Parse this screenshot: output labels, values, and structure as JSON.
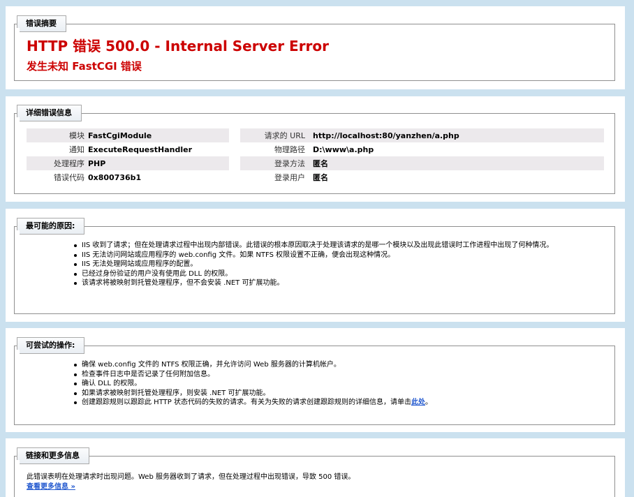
{
  "summary": {
    "tab": "错误摘要",
    "title": "HTTP 错误 500.0 - Internal Server Error",
    "subtitle": "发生未知 FastCGI 错误"
  },
  "details": {
    "tab": "详细错误信息",
    "left": [
      {
        "label": "模块",
        "value": "FastCgiModule"
      },
      {
        "label": "通知",
        "value": "ExecuteRequestHandler"
      },
      {
        "label": "处理程序",
        "value": "PHP"
      },
      {
        "label": "错误代码",
        "value": "0x800736b1"
      }
    ],
    "right": [
      {
        "label": "请求的 URL",
        "value": "http://localhost:80/yanzhen/a.php"
      },
      {
        "label": "物理路径",
        "value": "D:\\www\\a.php"
      },
      {
        "label": "登录方法",
        "value": "匿名"
      },
      {
        "label": "登录用户",
        "value": "匿名"
      }
    ]
  },
  "causes": {
    "tab": "最可能的原因:",
    "items": [
      "IIS 收到了请求；但在处理请求过程中出现内部错误。此错误的根本原因取决于处理该请求的是哪一个模块以及出现此错误时工作进程中出现了何种情况。",
      "IIS 无法访问网站或应用程序的 web.config 文件。如果 NTFS 权限设置不正确，便会出现这种情况。",
      "IIS 无法处理网站或应用程序的配置。",
      "已经过身份验证的用户没有使用此 DLL 的权限。",
      "该请求将被映射到托管处理程序，但不会安装 .NET 可扩展功能。"
    ]
  },
  "actions": {
    "tab": "可尝试的操作:",
    "items": [
      "确保 web.config 文件的 NTFS 权限正确，并允许访问 Web 服务器的计算机帐户。",
      "检查事件日志中是否记录了任何附加信息。",
      "确认 DLL 的权限。",
      "如果请求被映射到托管处理程序，则安装 .NET 可扩展功能。"
    ],
    "last_item_text": "创建跟踪规则以跟踪此 HTTP 状态代码的失败的请求。有关为失败的请求创建跟踪规则的详细信息，请单击",
    "last_item_link": "此处",
    "last_item_end": "。"
  },
  "more": {
    "tab": "链接和更多信息",
    "text": "此错误表明在处理请求时出现问题。Web 服务器收到了请求，但在处理过程中出现错误，导致 500 错误。",
    "link": "查看更多信息 »"
  }
}
